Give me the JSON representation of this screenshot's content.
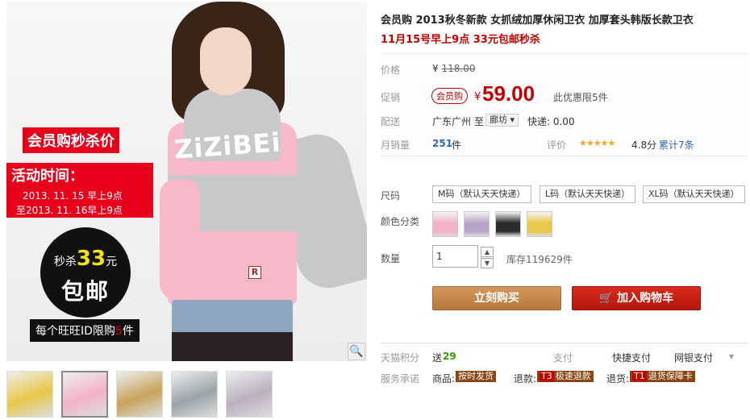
{
  "gallery": {
    "promo_title": "会员购秒杀价",
    "time_label": "活动时间：",
    "time_line1": "2013. 11. 15  早上9点",
    "time_line2": "至2013. 11. 16早上9点",
    "circle_prefix": "秒杀",
    "circle_amount": "33",
    "circle_unit": "元",
    "circle_bottom": "包邮",
    "limit_prefix": "每个旺旺ID限购",
    "limit_num": "5",
    "limit_suffix": "件",
    "sweater_logo": "ZiZiBEi",
    "sweater_tag": "R",
    "zoom_icon": "magnifier-icon",
    "thumbnails": [
      {
        "color": "#e8c84a",
        "active": false
      },
      {
        "color": "#f3b3c5",
        "active": true
      },
      {
        "color": "#c7a35c",
        "active": false
      },
      {
        "color": "#9aa4a8",
        "active": false
      },
      {
        "color": "#b9b0c0",
        "active": false
      }
    ]
  },
  "product": {
    "title": "会员购 2013秋冬新款 女抓绒加厚休闲卫衣 加厚套头韩版长款卫衣",
    "subtitle": "11月15号早上9点 33元包邮秒杀"
  },
  "price": {
    "orig_label": "价格",
    "orig_currency": "¥",
    "orig_value": "118.00",
    "promo_label": "促销",
    "vip_badge": "会员购",
    "promo_currency": "¥",
    "promo_value": "59.00",
    "promo_note": "此优惠限5件",
    "ship_label": "配送",
    "ship_from": "广东广州",
    "ship_to_word": "至",
    "ship_to": "廊坊",
    "ship_fee": "快递: 0.00",
    "sales_label": "月销量",
    "sales_value": "251",
    "sales_unit": "件",
    "rating_label": "评价",
    "rating_stars": "★★★★★",
    "rating_score": "4.8分",
    "rating_total": "累计7条"
  },
  "options": {
    "size_label": "尺码",
    "sizes": [
      "M码（默认天天快递）",
      "L码（默认天天快递）",
      "XL码（默认天天快递）"
    ],
    "color_label": "颜色分类",
    "colors": [
      "#f3b3c5",
      "#b8a3c8",
      "#2c2c2c",
      "#e8c84a"
    ],
    "qty_label": "数量",
    "qty_value": "1",
    "stock": "库存119629件",
    "buy_now": "立刻购买",
    "add_cart": "加入购物车",
    "cart_icon": "cart-icon"
  },
  "footer": {
    "points_label": "天猫积分",
    "points_prefix": "送",
    "points_value": "29",
    "pay_label": "支付",
    "pay_quick": "快捷支付",
    "pay_bank": "网银支付",
    "service_label": "服务承诺",
    "svc_goods": "商品:",
    "svc_goods_tag": "按时发货",
    "svc_return": "退款:",
    "svc_return_code": "T3",
    "svc_return_tag": "极速退款",
    "svc_refund": "退货:",
    "svc_refund_code": "T1",
    "svc_refund_tag": "退货保障卡"
  }
}
